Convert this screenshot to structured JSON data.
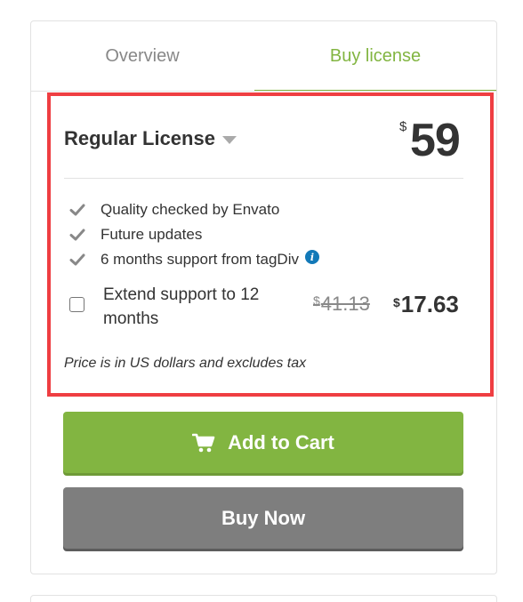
{
  "tabs": {
    "overview": "Overview",
    "buy_license": "Buy license"
  },
  "license": {
    "title": "Regular License",
    "currency": "$",
    "price": "59"
  },
  "features": [
    "Quality checked by Envato",
    "Future updates",
    "6 months support from tagDiv"
  ],
  "extend_support": {
    "label": "Extend support to 12 months",
    "old_currency": "$",
    "old_price": "41.13",
    "new_currency": "$",
    "new_price": "17.63"
  },
  "tax_note": "Price is in US dollars and excludes tax",
  "buttons": {
    "add_to_cart": "Add to Cart",
    "buy_now": "Buy Now"
  },
  "icons": {
    "check": "check-icon",
    "info": "info-icon",
    "cart": "cart-icon",
    "caret": "caret-down-icon"
  },
  "colors": {
    "accent_green": "#82b541",
    "highlight_red": "#ef3e42",
    "buy_gray": "#7e7e7e",
    "info_blue": "#1279b8"
  }
}
